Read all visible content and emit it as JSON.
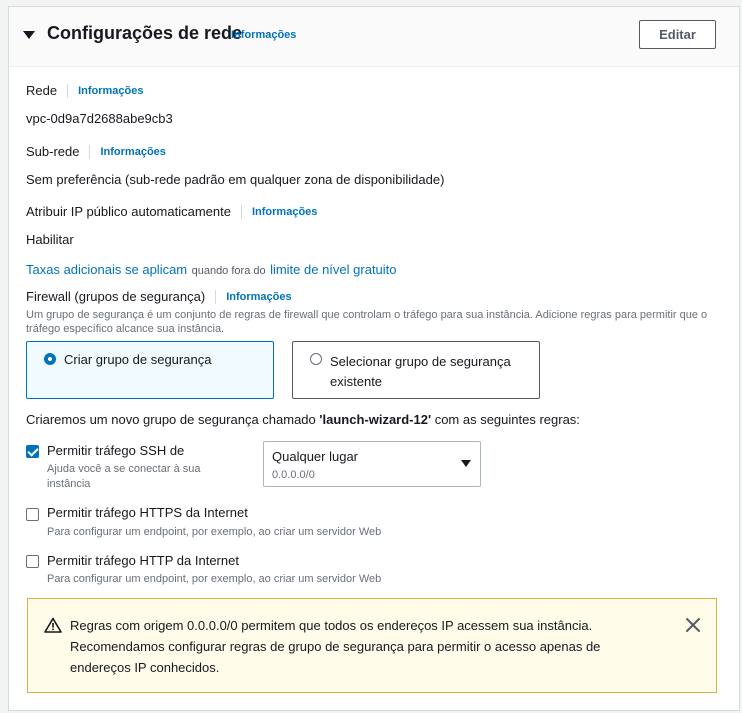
{
  "header": {
    "title": "Configurações de rede",
    "info_label": "Informações",
    "edit_label": "Editar"
  },
  "network": {
    "label": "Rede",
    "info_label": "Informações",
    "value": "vpc-0d9a7d2688abe9cb3"
  },
  "subnet": {
    "label": "Sub-rede",
    "info_label": "Informações",
    "value": "Sem preferência (sub-rede padrão em qualquer zona de disponibilidade)"
  },
  "public_ip": {
    "label": "Atribuir IP público automaticamente",
    "info_label": "Informações",
    "value": "Habilitar"
  },
  "charges": {
    "link1": "Taxas adicionais se aplicam",
    "middle": "quando fora do",
    "link2": "limite de nível gratuito"
  },
  "firewall": {
    "label": "Firewall (grupos de segurança)",
    "info_label": "Informações",
    "description": "Um grupo de segurança é um conjunto de regras de firewall que controlam o tráfego para sua instância. Adicione regras para permitir que o tráfego específico alcance sua instância.",
    "option_create": "Criar grupo de segurança",
    "option_select": "Selecionar grupo de segurança existente",
    "selected": "create"
  },
  "rules": {
    "intro_prefix": "Criaremos um novo grupo de segurança chamado",
    "group_name": "'launch-wizard-12'",
    "intro_suffix": "com as seguintes regras:",
    "ssh": {
      "label": "Permitir tráfego SSH de",
      "description": "Ajuda você a se conectar à sua instância",
      "checked": true,
      "source_value": "Qualquer lugar",
      "source_sub": "0.0.0.0/0"
    },
    "https": {
      "label": "Permitir tráfego HTTPS da Internet",
      "description": "Para configurar um endpoint, por exemplo, ao criar um servidor Web",
      "checked": false
    },
    "http": {
      "label": "Permitir tráfego HTTP da Internet",
      "description": "Para configurar um endpoint, por exemplo, ao criar um servidor Web",
      "checked": false
    }
  },
  "warning": {
    "text": "Regras com origem 0.0.0.0/0 permitem que todos os endereços IP acessem sua instância. Recomendamos configurar regras de grupo de segurança para permitir o acesso apenas de endereços IP conhecidos.",
    "icon": "warning-icon",
    "close_icon": "close-icon"
  },
  "colors": {
    "link": "#0073bb",
    "warning_bg": "#fffce9",
    "warning_border": "#d5b13f"
  }
}
